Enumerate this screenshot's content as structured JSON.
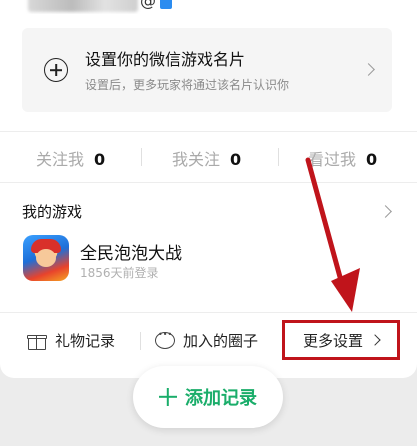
{
  "profile": {
    "masked_name_visible": "@"
  },
  "promo_card": {
    "title": "设置你的微信游戏名片",
    "subtitle": "设置后，更多玩家将通过该名片认识你"
  },
  "stats": [
    {
      "label": "关注我",
      "value": "0"
    },
    {
      "label": "我关注",
      "value": "0"
    },
    {
      "label": "看过我",
      "value": "0"
    }
  ],
  "my_games": {
    "title": "我的游戏",
    "items": [
      {
        "name": "全民泡泡大战",
        "subtitle": "1856天前登录"
      }
    ]
  },
  "toolbar": {
    "gift_label": "礼物记录",
    "circles_label": "加入的圈子",
    "more_settings_label": "更多设置"
  },
  "fab": {
    "label": "添加记录"
  },
  "colors": {
    "accent_green": "#1aad6a",
    "annotation_red": "#c0141b"
  }
}
